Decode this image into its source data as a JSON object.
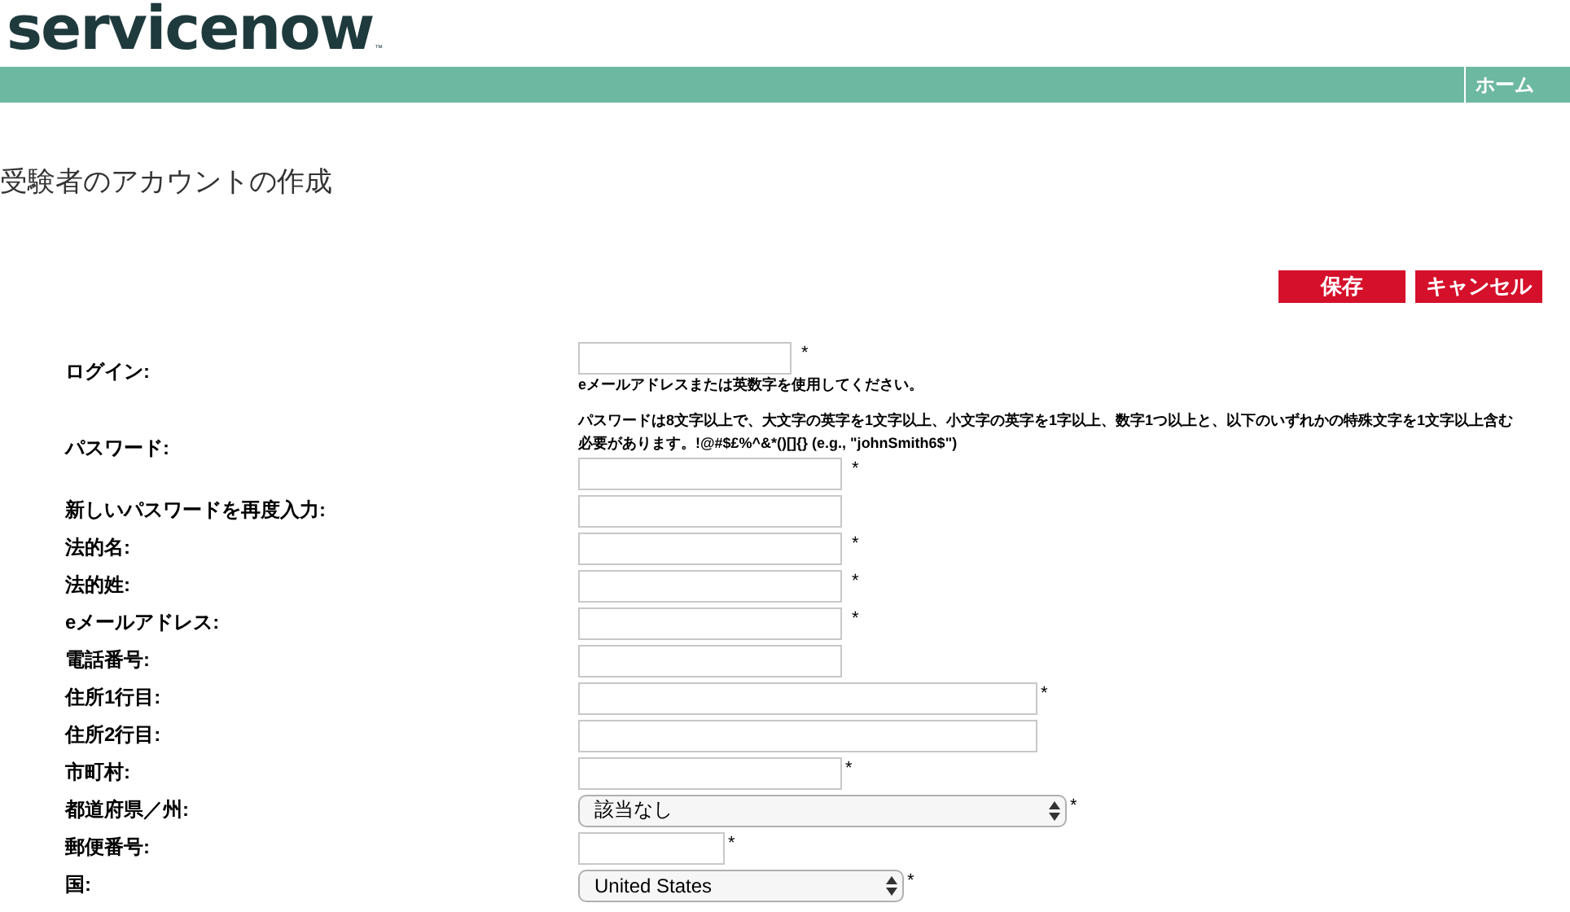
{
  "header": {
    "logo": "servicenow",
    "trademark": "™",
    "nav": [
      {
        "label": "ホーム"
      }
    ]
  },
  "page_title": "受験者のアカウントの作成",
  "buttons": [
    {
      "label": "保存"
    },
    {
      "label": "キャンセル"
    }
  ],
  "form": {
    "fields": [
      {
        "label": "ログイン:",
        "kind": "text",
        "required_mark": "*",
        "hint_after": "eメールアドレスまたは英数字を使用してください。"
      },
      {
        "label": "パスワード:",
        "kind": "password",
        "required_mark": "*",
        "hint_before": "パスワードは8文字以上で、大文字の英字を1文字以上、小文字の英字を1字以上、数字1つ以上と、以下のいずれかの特殊文字を1文字以上含む必要があります。!@#$£%^&*()[]{} (e.g., \"johnSmith6$\")"
      },
      {
        "label": "新しいパスワードを再度入力:",
        "kind": "password"
      },
      {
        "label": "法的名:",
        "kind": "text",
        "required_mark": "*"
      },
      {
        "label": "法的姓:",
        "kind": "text",
        "required_mark": "*"
      },
      {
        "label": "eメールアドレス:",
        "kind": "text",
        "required_mark": "*"
      },
      {
        "label": "電話番号:",
        "kind": "text"
      },
      {
        "label": "住所1行目:",
        "kind": "text",
        "required_mark": "*"
      },
      {
        "label": "住所2行目:",
        "kind": "text"
      },
      {
        "label": "市町村:",
        "kind": "text",
        "required_mark": "*"
      },
      {
        "label": "都道府県／州:",
        "kind": "select",
        "value": "該当なし",
        "required_mark": "*"
      },
      {
        "label": "郵便番号:",
        "kind": "text",
        "required_mark": "*"
      },
      {
        "label": "国:",
        "kind": "select",
        "value": "United States",
        "required_mark": "*"
      }
    ]
  }
}
